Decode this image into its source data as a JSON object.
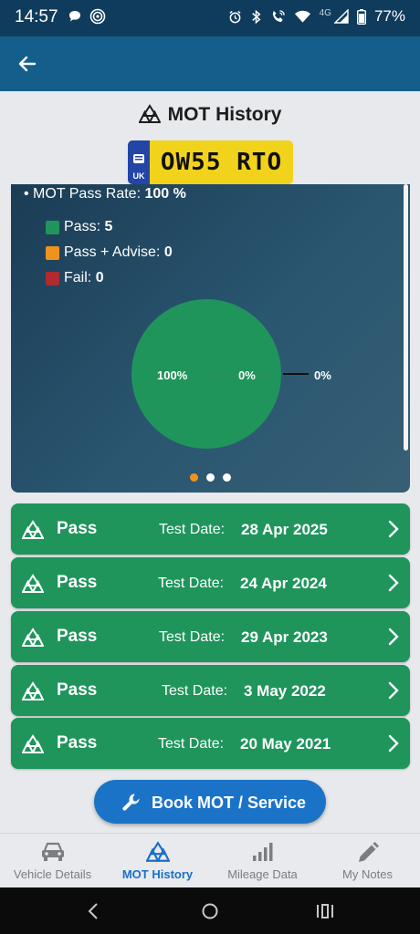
{
  "status_bar": {
    "time": "14:57",
    "network": "4G",
    "battery": "77%",
    "left_icons": [
      "chat-bubble-icon",
      "nfc-icon"
    ],
    "right_icons": [
      "alarm-icon",
      "bluetooth-icon",
      "wifi-calling-icon",
      "wifi-icon",
      "signal-icon",
      "battery-icon"
    ]
  },
  "app_bar": {
    "back_icon": "arrow-left-icon"
  },
  "page": {
    "title": "MOT History",
    "plate": {
      "country": "UK",
      "registration": "OW55 RTO"
    }
  },
  "summary": {
    "pass_rate_label": "• MOT Pass Rate:",
    "pass_rate_value": "100 %",
    "legend": [
      {
        "label": "Pass:",
        "count": "5",
        "color": "#1f955c"
      },
      {
        "label": "Pass + Advise:",
        "count": "0",
        "color": "#ef931e"
      },
      {
        "label": "Fail:",
        "count": "0",
        "color": "#b02a30"
      }
    ]
  },
  "chart_data": {
    "type": "pie",
    "categories": [
      "Pass",
      "Pass + Advise",
      "Fail"
    ],
    "values": [
      5,
      0,
      0
    ],
    "labels": [
      "100%",
      "0%",
      "0%"
    ],
    "colors": [
      "#1f955c",
      "#ef931e",
      "#b02a30"
    ]
  },
  "carousel": {
    "pages": 3,
    "active": 0
  },
  "history": {
    "test_date_label": "Test Date:",
    "items": [
      {
        "result": "Pass",
        "date": "28 Apr 2025"
      },
      {
        "result": "Pass",
        "date": "24 Apr 2024"
      },
      {
        "result": "Pass",
        "date": "29 Apr 2023"
      },
      {
        "result": "Pass",
        "date": "3 May 2022"
      },
      {
        "result": "Pass",
        "date": "20 May 2021"
      }
    ]
  },
  "book_button": {
    "label": "Book MOT / Service",
    "icon": "wrench-icon"
  },
  "bottom_nav": {
    "items": [
      {
        "label": "Vehicle Details",
        "icon": "car-icon"
      },
      {
        "label": "MOT History",
        "icon": "mot-triangle-icon"
      },
      {
        "label": "Mileage Data",
        "icon": "bar-chart-icon"
      },
      {
        "label": "My Notes",
        "icon": "pencil-icon"
      }
    ],
    "active_index": 1
  },
  "system_nav": {
    "icons": [
      "back-icon",
      "home-icon",
      "recents-icon"
    ]
  }
}
